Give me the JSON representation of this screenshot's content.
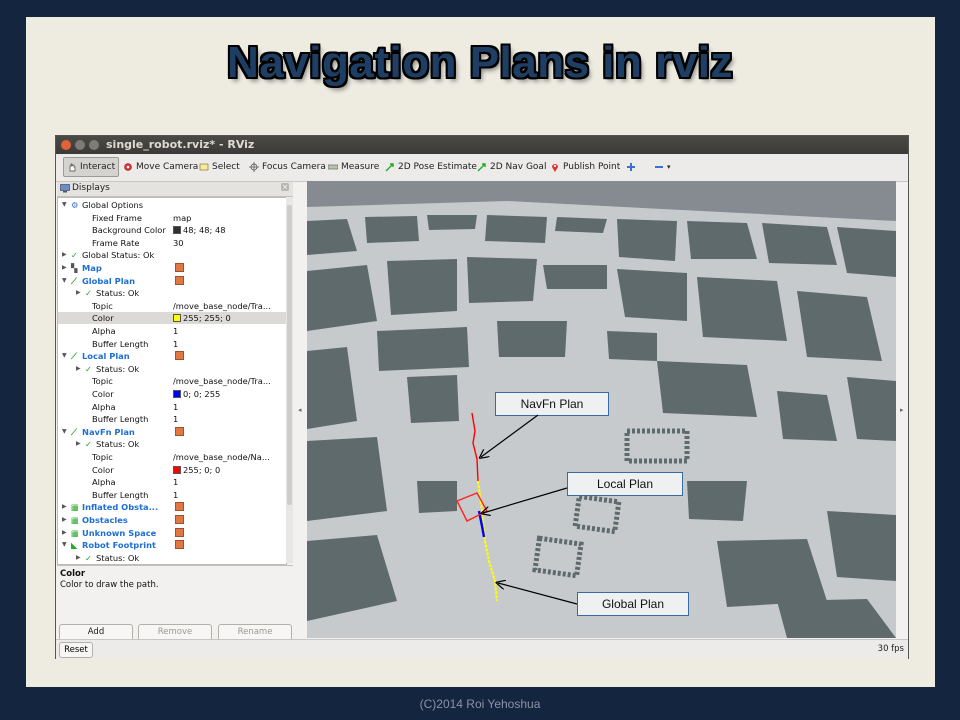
{
  "slide": {
    "title": "Navigation Plans in rviz",
    "footer": "(C)2014 Roi Yehoshua"
  },
  "window": {
    "title": "single_robot.rviz* - RViz"
  },
  "toolbar": {
    "interact": "Interact",
    "move_camera": "Move Camera",
    "select": "Select",
    "focus_camera": "Focus Camera",
    "measure": "Measure",
    "pose_estimate": "2D Pose Estimate",
    "nav_goal": "2D Nav Goal",
    "publish_point": "Publish Point"
  },
  "displays": {
    "header": "Displays",
    "rows": [
      {
        "label": "Global Options",
        "value": "",
        "indent": 0,
        "arrow": "down",
        "icon": "gear-icon"
      },
      {
        "label": "Fixed Frame",
        "value": "map",
        "indent": 2
      },
      {
        "label": "Background Color",
        "value": "48; 48; 48",
        "indent": 2,
        "swatch": "#303030"
      },
      {
        "label": "Frame Rate",
        "value": "30",
        "indent": 2
      },
      {
        "label": "Global Status: Ok",
        "value": "",
        "indent": 0,
        "arrow": "right",
        "icon": "check-icon"
      },
      {
        "label": "Map",
        "value": "",
        "indent": 0,
        "arrow": "right",
        "icon": "map-icon",
        "plugin": true,
        "checked": true
      },
      {
        "label": "Global Plan",
        "value": "",
        "indent": 0,
        "arrow": "down",
        "icon": "path-icon",
        "plugin": true,
        "checked": true
      },
      {
        "label": "Status: Ok",
        "value": "",
        "indent": 1,
        "arrow": "right",
        "icon": "check-icon"
      },
      {
        "label": "Topic",
        "value": "/move_base_node/Tra...",
        "indent": 2
      },
      {
        "label": "Color",
        "value": "255; 255; 0",
        "indent": 2,
        "swatch": "#ffff00",
        "selected": true
      },
      {
        "label": "Alpha",
        "value": "1",
        "indent": 2
      },
      {
        "label": "Buffer Length",
        "value": "1",
        "indent": 2
      },
      {
        "label": "Local Plan",
        "value": "",
        "indent": 0,
        "arrow": "down",
        "icon": "path-icon",
        "plugin": true,
        "checked": true
      },
      {
        "label": "Status: Ok",
        "value": "",
        "indent": 1,
        "arrow": "right",
        "icon": "check-icon"
      },
      {
        "label": "Topic",
        "value": "/move_base_node/Tra...",
        "indent": 2
      },
      {
        "label": "Color",
        "value": "0; 0; 255",
        "indent": 2,
        "swatch": "#0000ff"
      },
      {
        "label": "Alpha",
        "value": "1",
        "indent": 2
      },
      {
        "label": "Buffer Length",
        "value": "1",
        "indent": 2
      },
      {
        "label": "NavFn Plan",
        "value": "",
        "indent": 0,
        "arrow": "down",
        "icon": "path-icon",
        "plugin": true,
        "checked": true
      },
      {
        "label": "Status: Ok",
        "value": "",
        "indent": 1,
        "arrow": "right",
        "icon": "check-icon"
      },
      {
        "label": "Topic",
        "value": "/move_base_node/Na...",
        "indent": 2
      },
      {
        "label": "Color",
        "value": "255; 0; 0",
        "indent": 2,
        "swatch": "#ff0000"
      },
      {
        "label": "Alpha",
        "value": "1",
        "indent": 2
      },
      {
        "label": "Buffer Length",
        "value": "1",
        "indent": 2
      },
      {
        "label": "Inflated Obsta...",
        "value": "",
        "indent": 0,
        "arrow": "right",
        "icon": "grid-icon",
        "plugin": true,
        "checked": true
      },
      {
        "label": "Obstacles",
        "value": "",
        "indent": 0,
        "arrow": "right",
        "icon": "grid-icon",
        "plugin": true,
        "checked": true
      },
      {
        "label": "Unknown Space",
        "value": "",
        "indent": 0,
        "arrow": "right",
        "icon": "grid-icon",
        "plugin": true,
        "checked": true
      },
      {
        "label": "Robot Footprint",
        "value": "",
        "indent": 0,
        "arrow": "down",
        "icon": "polygon-icon",
        "plugin": true,
        "checked": true
      },
      {
        "label": "Status: Ok",
        "value": "",
        "indent": 1,
        "arrow": "right",
        "icon": "check-icon"
      }
    ],
    "description_title": "Color",
    "description_body": "Color to draw the path.",
    "add": "Add",
    "remove": "Remove",
    "rename": "Rename"
  },
  "bottom": {
    "reset": "Reset",
    "fps": "30 fps"
  },
  "callouts": {
    "navfn": "NavFn Plan",
    "local": "Local Plan",
    "global": "Global Plan"
  },
  "colors": {
    "global_plan": "#ffff00",
    "local_plan": "#0000ff",
    "navfn_plan": "#ff0000",
    "title": "#1f3e63",
    "background": "#14263f"
  }
}
